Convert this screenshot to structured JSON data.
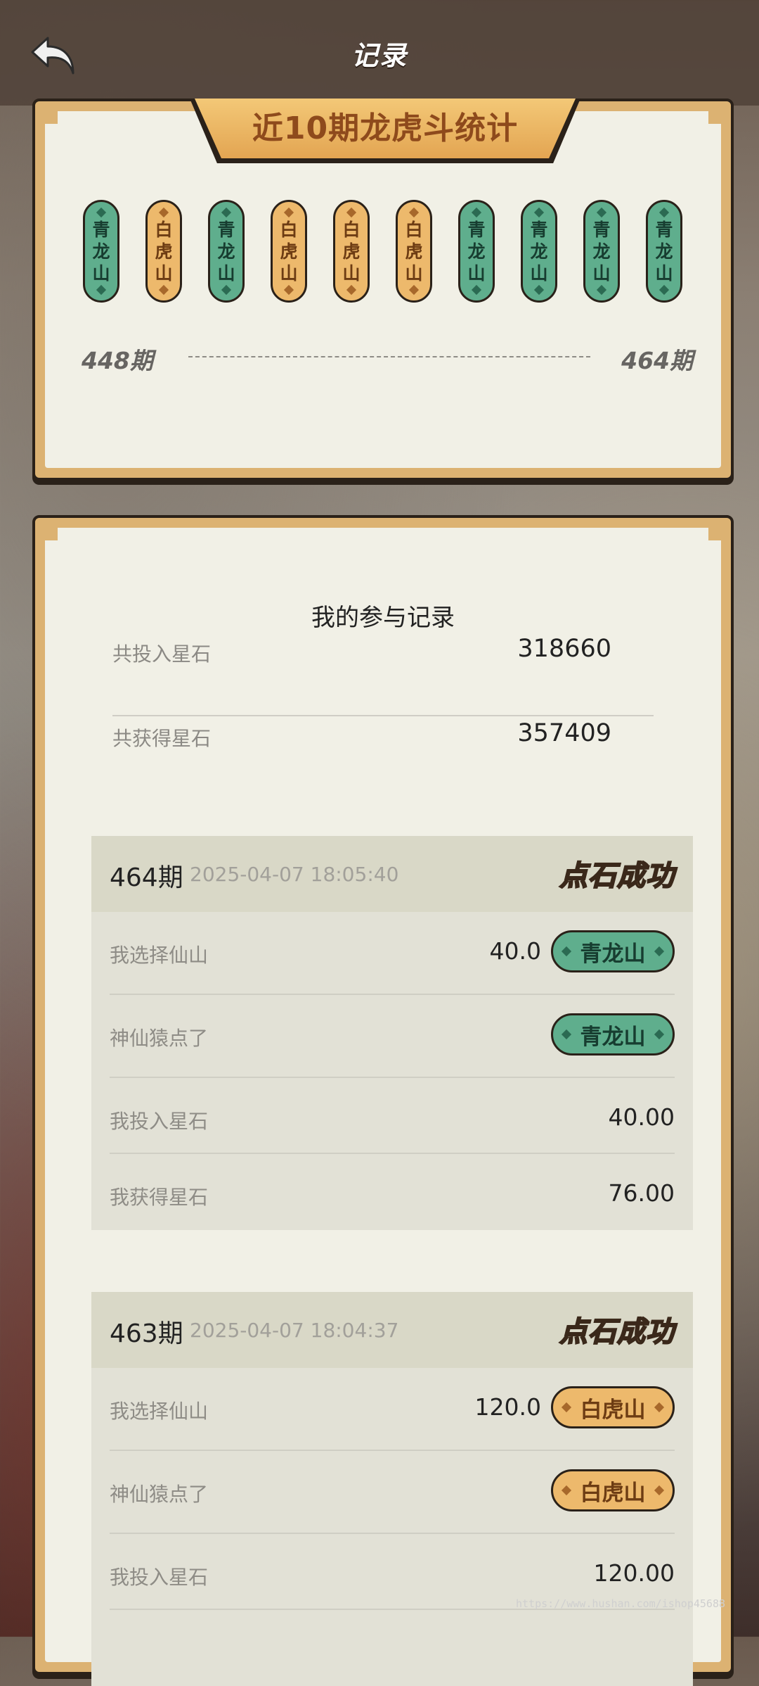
{
  "header": {
    "title": "记录",
    "back_icon": "back-arrow-icon"
  },
  "stats": {
    "banner_title": "近10期龙虎斗统计",
    "tokens": [
      {
        "label": "青龙山",
        "color": "green"
      },
      {
        "label": "白虎山",
        "color": "orange"
      },
      {
        "label": "青龙山",
        "color": "green"
      },
      {
        "label": "白虎山",
        "color": "orange"
      },
      {
        "label": "白虎山",
        "color": "orange"
      },
      {
        "label": "白虎山",
        "color": "orange"
      },
      {
        "label": "青龙山",
        "color": "green"
      },
      {
        "label": "青龙山",
        "color": "green"
      },
      {
        "label": "青龙山",
        "color": "green"
      },
      {
        "label": "青龙山",
        "color": "green"
      }
    ],
    "period_start": "448期",
    "period_end": "464期"
  },
  "records": {
    "title": "我的参与记录",
    "total_in_label": "共投入星石",
    "total_in_value": "318660",
    "total_out_label": "共获得星石",
    "total_out_value": "357409",
    "cards": [
      {
        "period": "464期",
        "date": "2025-04-07 18:05:40",
        "status": "点石成功",
        "choice_label": "我选择仙山",
        "choice_amount": "40.0",
        "choice_pill": "青龙山",
        "result_label": "神仙猿点了",
        "result_pill": "青龙山",
        "invest_label": "我投入星石",
        "invest_value": "40.00",
        "gain_label": "我获得星石",
        "gain_value": "76.00"
      },
      {
        "period": "463期",
        "date": "2025-04-07 18:04:37",
        "status": "点石成功",
        "choice_label": "我选择仙山",
        "choice_amount": "120.0",
        "choice_pill": "白虎山",
        "result_label": "神仙猿点了",
        "result_pill": "白虎山",
        "invest_label": "我投入星石",
        "invest_value": "120.00"
      }
    ]
  },
  "watermark": "https://www.hushan.com/ishop45688",
  "colors": {
    "green": "#5fae8d",
    "orange": "#edb96c",
    "panel_border": "#dcb272",
    "panel_bg": "#f1f0e6"
  }
}
